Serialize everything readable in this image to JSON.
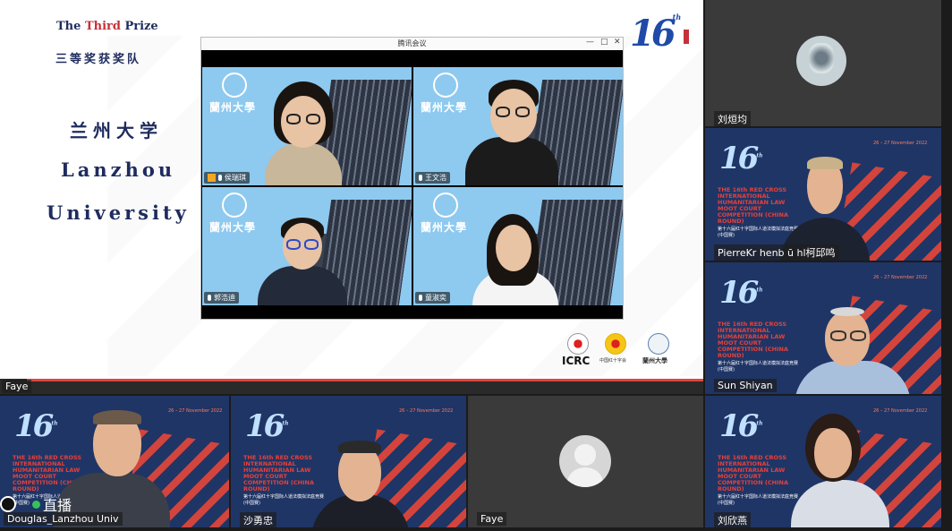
{
  "shared_screen": {
    "prize_prefix": "The ",
    "prize_highlight": "Third",
    "prize_suffix": " Prize",
    "prize_cn": "三等奖获奖队",
    "university_cn": "兰州大学",
    "university_en_line1": "Lanzhou",
    "university_en_line2": "University",
    "edition_number": "16",
    "edition_suffix": "th",
    "meeting_window": {
      "title": "腾讯会议",
      "controls": [
        "—",
        "□",
        "✕"
      ],
      "tiles": [
        {
          "name": "侯瑞琪"
        },
        {
          "name": "王文浩"
        },
        {
          "name": "郭浩迪"
        },
        {
          "name": "童淑奕"
        }
      ],
      "emblem_text": "蘭州大學"
    },
    "footer_logos": {
      "icrc": "ICRC",
      "rcsc": "中国红十字会",
      "lzu": "蘭州大學"
    }
  },
  "presenter_label": "Faye",
  "participants": [
    {
      "name": "刘烜均"
    },
    {
      "name": "PierreKr henb ū hl柯邱鸣"
    },
    {
      "name": "Sun Shiyan"
    },
    {
      "name": "Douglas_Lanzhou Univ"
    },
    {
      "name": "沙勇忠"
    },
    {
      "name": "Faye"
    },
    {
      "name": "刘欣燕"
    }
  ],
  "competition_bg": {
    "number": "16",
    "suffix": "th",
    "title_en": "THE 16th RED CROSS INTERNATIONAL HUMANITARIAN LAW MOOT COURT COMPETITION (CHINA ROUND)",
    "title_cn": "第十六届红十字国际人道法模拟法庭竞赛(中国赛)",
    "dates": "26 – 27 November 2022"
  },
  "live_badge": "直播",
  "colors": {
    "navy": "#1e2b5e",
    "accent_red": "#c5303a",
    "tile_blue": "#1f3566",
    "live_green": "#37c05b"
  }
}
